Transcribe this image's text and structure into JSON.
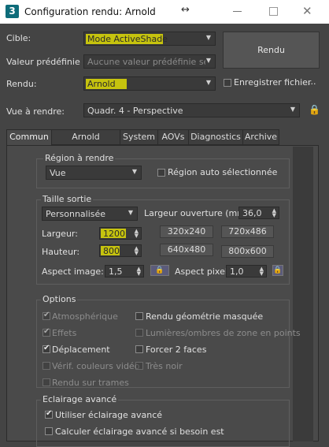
{
  "window": {
    "app_icon": "3",
    "title": "Configuration rendu: Arnold",
    "resize_glyph": "↔",
    "close_glyph": "✕"
  },
  "top": {
    "cible_label": "Cible:",
    "cible_value": "Mode ActiveShade",
    "preset_label": "Valeur prédéfinie :",
    "preset_value": "Aucune valeur prédéfinie sélect",
    "rendu_label": "Rendu:",
    "rendu_value": "Arnold",
    "save_file_label": "Enregistrer fichier",
    "more_label": "...",
    "view_label": "Vue à rendre:",
    "view_value": "Quadr. 4 - Perspective",
    "render_button": "Rendu"
  },
  "tabs": [
    "Commun",
    "Arnold Renderer",
    "System",
    "AOVs",
    "Diagnostics",
    "Archive"
  ],
  "region": {
    "title": "Région à rendre",
    "value": "Vue",
    "auto_label": "Région auto sélectionnée"
  },
  "output": {
    "title": "Taille sortie",
    "preset": "Personnalisée",
    "aperture_label": "Largeur ouverture (mm):",
    "aperture_value": "36,0",
    "width_label": "Largeur:",
    "width_value": "1200",
    "height_label": "Hauteur:",
    "height_value": "800",
    "sizes": [
      "320x240",
      "720x486",
      "640x480",
      "800x600"
    ],
    "aspect_image_label": "Aspect image:",
    "aspect_image_value": "1,5",
    "aspect_pixel_label": "Aspect pixel:",
    "aspect_pixel_value": "1,0"
  },
  "options": {
    "title": "Options",
    "items": [
      {
        "label": "Atmosphérique",
        "checked": true,
        "enabled": false
      },
      {
        "label": "Rendu géométrie masquée",
        "checked": false,
        "enabled": true
      },
      {
        "label": "Effets",
        "checked": true,
        "enabled": false
      },
      {
        "label": "Lumières/ombres de zone en points",
        "checked": false,
        "enabled": false
      },
      {
        "label": "Déplacement",
        "checked": true,
        "enabled": true
      },
      {
        "label": "Forcer 2 faces",
        "checked": false,
        "enabled": true
      },
      {
        "label": "Vérif. couleurs vidéo",
        "checked": false,
        "enabled": false
      },
      {
        "label": "Très noir",
        "checked": false,
        "enabled": false
      },
      {
        "label": "Rendu sur trames",
        "checked": false,
        "enabled": false
      }
    ]
  },
  "advanced": {
    "title": "Eclairage avancé",
    "use_label": "Utiliser éclairage avancé",
    "compute_label": "Calculer éclairage avancé si besoin est"
  },
  "colors": {
    "highlight": "#f5f200",
    "panel_bg": "#4a4a4a",
    "window_bg": "#444444"
  }
}
